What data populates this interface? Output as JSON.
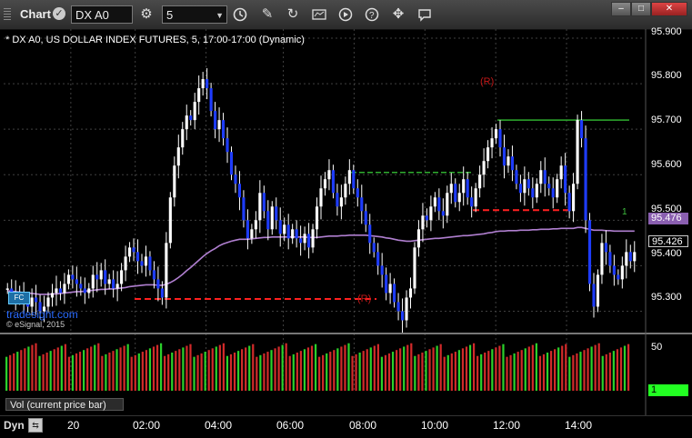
{
  "toolbar": {
    "title": "Chart",
    "symbol": "DX A0",
    "interval": "5"
  },
  "chart": {
    "title": "* DX A0, US DOLLAR INDEX FUTURES, 5, 17:00-17:00 (Dynamic)",
    "watermark": "tradesight.com",
    "copyright": "© eSignal, 2015",
    "fc_badge": "FC",
    "price_labels": [
      "95.900",
      "95.800",
      "95.700",
      "95.600",
      "95.500",
      "95.400",
      "95.300"
    ],
    "ma_tag": "95.476",
    "last_tag": "95.426",
    "markers": {
      "r_top": "(R)",
      "r_bottom": "(R)",
      "sequential_1": "1"
    },
    "colors": {
      "up": "#ffffff",
      "down": "#1e3cff",
      "ma": "#b07fd0",
      "support": "#ff2020",
      "resistance": "#2fae2f",
      "grid": "#404040"
    }
  },
  "volume": {
    "label": "Vol (current price bar)",
    "axis_label": "50",
    "last_tag": "1"
  },
  "bottom": {
    "mode": "Dyn",
    "times": [
      "20",
      "02:00",
      "04:00",
      "06:00",
      "08:00",
      "10:00",
      "12:00",
      "14:00"
    ]
  },
  "chart_data": {
    "type": "candlestick",
    "ylim": [
      95.255,
      95.92
    ],
    "closes": [
      95.35,
      95.34,
      95.33,
      95.34,
      95.32,
      95.31,
      95.33,
      95.32,
      95.3,
      95.31,
      95.33,
      95.34,
      95.35,
      95.34,
      95.36,
      95.38,
      95.37,
      95.36,
      95.35,
      95.34,
      95.35,
      95.38,
      95.37,
      95.39,
      95.36,
      95.37,
      95.35,
      95.36,
      95.39,
      95.42,
      95.44,
      95.43,
      95.41,
      95.4,
      95.42,
      95.39,
      95.37,
      95.35,
      95.33,
      95.45,
      95.55,
      95.62,
      95.66,
      95.7,
      95.73,
      95.72,
      95.76,
      95.79,
      95.81,
      95.79,
      95.74,
      95.7,
      95.72,
      95.68,
      95.65,
      95.6,
      95.58,
      95.55,
      95.5,
      95.46,
      95.48,
      95.5,
      95.56,
      95.52,
      95.48,
      95.53,
      95.5,
      95.47,
      95.49,
      95.46,
      95.48,
      95.46,
      95.45,
      95.47,
      95.44,
      95.48,
      95.53,
      95.57,
      95.59,
      95.61,
      95.56,
      95.53,
      95.55,
      95.58,
      95.61,
      95.57,
      95.55,
      95.52,
      95.49,
      95.45,
      95.43,
      95.4,
      95.38,
      95.34,
      95.36,
      95.32,
      95.3,
      95.28,
      95.33,
      95.35,
      95.44,
      95.48,
      95.51,
      95.5,
      95.53,
      95.55,
      95.52,
      95.51,
      95.56,
      95.58,
      95.54,
      95.56,
      95.59,
      95.55,
      95.53,
      95.57,
      95.6,
      95.63,
      95.66,
      95.68,
      95.7,
      95.66,
      95.62,
      95.64,
      95.61,
      95.58,
      95.56,
      95.59,
      95.57,
      95.55,
      95.58,
      95.61,
      95.58,
      95.57,
      95.55,
      95.59,
      95.62,
      95.56,
      95.52,
      95.58,
      95.72,
      95.68,
      95.5,
      95.36,
      95.31,
      95.38,
      95.45,
      95.43,
      95.4,
      95.38,
      95.37,
      95.4,
      95.43,
      95.41,
      95.43
    ],
    "ma": [
      95.345,
      95.344,
      95.343,
      95.342,
      95.341,
      95.34,
      95.339,
      95.338,
      95.337,
      95.337,
      95.337,
      95.338,
      95.338,
      95.339,
      95.34,
      95.341,
      95.342,
      95.343,
      95.343,
      95.344,
      95.345,
      95.346,
      95.347,
      95.348,
      95.348,
      95.349,
      95.349,
      95.35,
      95.351,
      95.352,
      95.354,
      95.355,
      95.356,
      95.357,
      95.358,
      95.358,
      95.358,
      95.357,
      95.357,
      95.359,
      95.363,
      95.368,
      95.374,
      95.381,
      95.389,
      95.396,
      95.404,
      95.412,
      95.42,
      95.427,
      95.433,
      95.438,
      95.444,
      95.448,
      95.451,
      95.454,
      95.456,
      95.458,
      95.458,
      95.458,
      95.459,
      95.46,
      95.461,
      95.462,
      95.462,
      95.463,
      95.463,
      95.463,
      95.463,
      95.463,
      95.463,
      95.463,
      95.463,
      95.463,
      95.462,
      95.462,
      95.462,
      95.463,
      95.464,
      95.465,
      95.465,
      95.465,
      95.466,
      95.466,
      95.467,
      95.467,
      95.467,
      95.467,
      95.467,
      95.466,
      95.465,
      95.464,
      95.463,
      95.461,
      95.46,
      95.458,
      95.456,
      95.455,
      95.454,
      95.454,
      95.455,
      95.456,
      95.457,
      95.458,
      95.459,
      95.46,
      95.46,
      95.461,
      95.462,
      95.463,
      95.464,
      95.465,
      95.466,
      95.466,
      95.467,
      95.468,
      95.469,
      95.47,
      95.472,
      95.473,
      95.475,
      95.476,
      95.476,
      95.477,
      95.477,
      95.477,
      95.478,
      95.478,
      95.478,
      95.479,
      95.479,
      95.48,
      95.48,
      95.48,
      95.481,
      95.481,
      95.482,
      95.482,
      95.482,
      95.482,
      95.484,
      95.484,
      95.482,
      95.48,
      95.478,
      95.478,
      95.478,
      95.477,
      95.477,
      95.476,
      95.476,
      95.476,
      95.476,
      95.476,
      95.476
    ],
    "support_level": 95.327,
    "resistance_levels": [
      95.72,
      95.605
    ],
    "mid_support": 95.522,
    "volume_ylim": [
      0,
      60
    ],
    "volume_axis_ticks": [
      50
    ]
  }
}
